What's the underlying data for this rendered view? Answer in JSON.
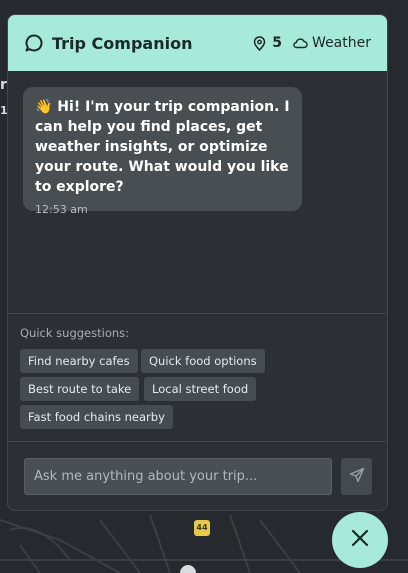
{
  "header": {
    "title": "Trip Companion",
    "places_count": "5",
    "weather_label": "Weather"
  },
  "message": {
    "text": "👋 Hi! I'm your trip companion. I can help you find places, get weather insights, or optimize your route. What would you like to explore?",
    "time": "12:53 am"
  },
  "suggestions": {
    "label": "Quick suggestions:",
    "items": [
      "Find nearby cafes",
      "Quick food options",
      "Best route to take",
      "Local street food",
      "Fast food chains nearby"
    ]
  },
  "input": {
    "placeholder": "Ask me anything about your trip..."
  },
  "map": {
    "road_badge": "44",
    "edge_text_1": "r",
    "edge_text_2": "1."
  },
  "colors": {
    "accent": "#a8ead9",
    "panel": "#2c3034",
    "bubble": "#494e52"
  }
}
